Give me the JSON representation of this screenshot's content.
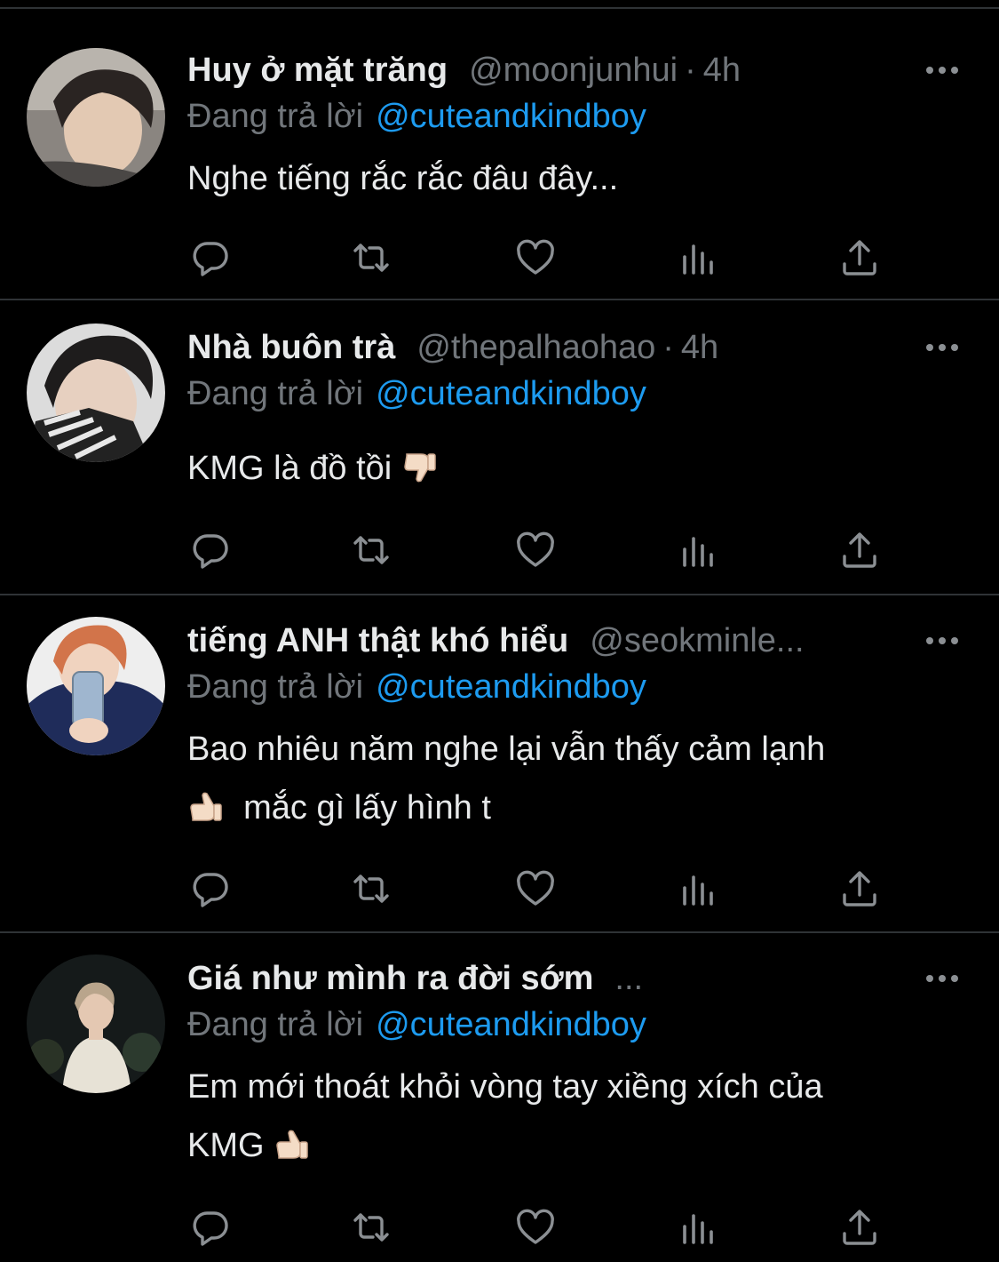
{
  "tweets": [
    {
      "name": "Huy ở mặt trăng",
      "handle": "@moonjunhui",
      "separator": "·",
      "time": "4h",
      "reply_prefix": "Đang trả lời",
      "reply_to": "@cuteandkindboy",
      "lines": [
        "Nghe tiếng rắc rắc đâu đây..."
      ]
    },
    {
      "name": "Nhà buôn trà",
      "handle": "@thepalhaohao",
      "separator": "·",
      "time": "4h",
      "reply_prefix": "Đang trả lời",
      "reply_to": "@cuteandkindboy",
      "lines": [
        "KMG là đồ tồi"
      ]
    },
    {
      "name": "tiếng ANH thật khó hiểu",
      "handle": "@seokminle...",
      "separator": "",
      "time": "",
      "reply_prefix": "Đang trả lời",
      "reply_to": "@cuteandkindboy",
      "lines": [
        "Bao nhiêu năm nghe lại vẫn thấy cảm lạnh",
        "mắc gì lấy hình t"
      ]
    },
    {
      "name": "Giá như mình ra đời sớm",
      "handle": "...",
      "separator": "",
      "time": "",
      "reply_prefix": "Đang trả lời",
      "reply_to": "@cuteandkindboy",
      "lines": [
        "Em mới thoát khỏi vòng tay xiềng xích của",
        "KMG"
      ]
    }
  ],
  "icons": {
    "more": "more-horizontal-icon",
    "reply": "reply-icon",
    "retweet": "retweet-icon",
    "like": "heart-icon",
    "views": "views-icon",
    "share": "share-icon",
    "emoji_down": "thumbs-down-emoji",
    "emoji_up": "thumbs-up-emoji"
  },
  "colors": {
    "background": "#000000",
    "text": "#e7e9ea",
    "muted": "#71767b",
    "link": "#1d9bf0",
    "divider": "#2f3336"
  }
}
